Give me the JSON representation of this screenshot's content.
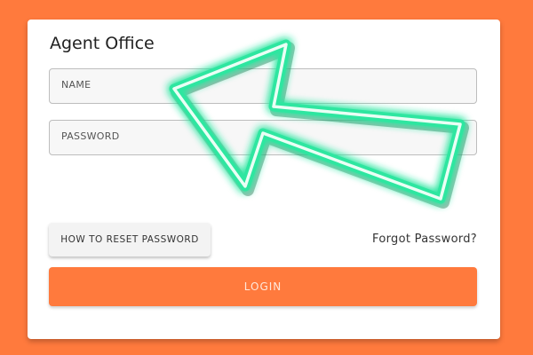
{
  "app": {
    "title": "Agent Office"
  },
  "form": {
    "name_placeholder": "NAME",
    "password_placeholder": "PASSWORD",
    "reset_password_label": "HOW TO RESET PASSWORD",
    "forgot_password_label": "Forgot Password?",
    "login_label": "LOGIN"
  },
  "overlay": {
    "arrow_icon": "neon-arrow-icon",
    "arrow_color": "#2fe6a0"
  },
  "colors": {
    "background": "#ff7a3d",
    "accent": "#ff7a3d",
    "card": "#ffffff"
  }
}
